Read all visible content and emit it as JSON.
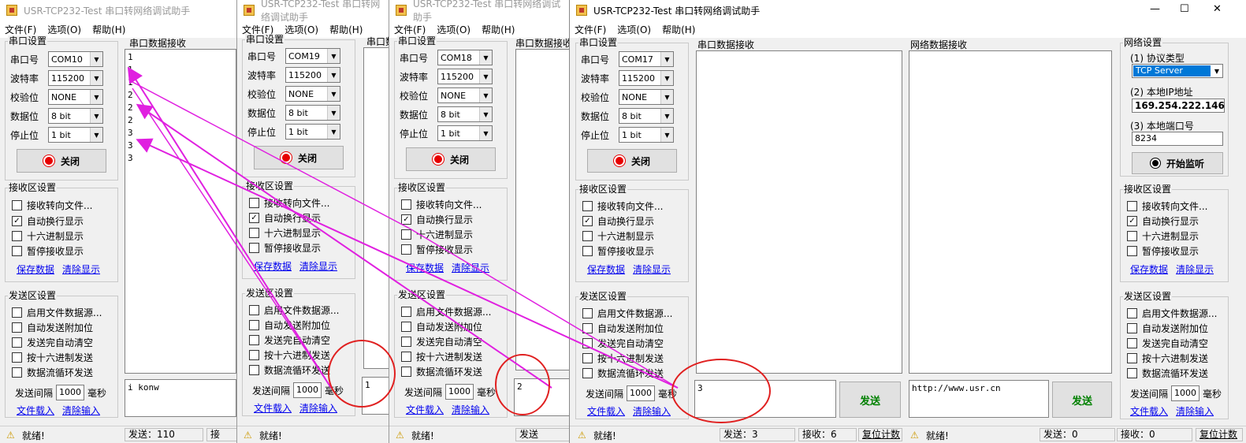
{
  "app_title": "USR-TCP232-Test 串口转网络调试助手",
  "menu": [
    "文件(F)",
    "选项(O)",
    "帮助(H)"
  ],
  "serial_group": "串口设置",
  "labels": {
    "port": "串口号",
    "baud": "波特率",
    "parity": "校验位",
    "data": "数据位",
    "stop": "停止位"
  },
  "close_btn": "关闭",
  "recv_group": "接收区设置",
  "recv_opts": [
    "接收转向文件...",
    "自动换行显示",
    "十六进制显示",
    "暂停接收显示"
  ],
  "recv_links": [
    "保存数据",
    "清除显示"
  ],
  "send_group": "发送区设置",
  "send_opts": [
    "启用文件数据源...",
    "自动发送附加位",
    "发送完自动清空",
    "按十六进制发送",
    "数据流循环发送"
  ],
  "interval_label": "发送间隔",
  "interval_val": "1000",
  "interval_unit": "毫秒",
  "send_links": [
    "文件载入",
    "清除输入"
  ],
  "serial_recv_title": "串口数据接收",
  "ready": "就绪!",
  "w1": {
    "port": "COM10",
    "baud": "115200",
    "parity": "NONE",
    "data": "8 bit",
    "stop": "1 bit",
    "recv": "1\n1\n1\n2\n2\n2\n3\n3\n3",
    "send": "i konw",
    "status_send": "发送：110",
    "status_recv": "接"
  },
  "w2": {
    "port": "COM19",
    "baud": "115200",
    "parity": "NONE",
    "data": "8 bit",
    "stop": "1 bit",
    "send": "1"
  },
  "w3": {
    "port": "COM18",
    "baud": "115200",
    "parity": "NONE",
    "data": "8 bit",
    "stop": "1 bit",
    "send": "2",
    "status_send": "发送"
  },
  "w4": {
    "port": "COM17",
    "baud": "115200",
    "parity": "NONE",
    "data": "8 bit",
    "stop": "1 bit",
    "send": "3",
    "send_btn": "发送",
    "net_recv_title": "网络数据接收",
    "net_send": "http://www.usr.cn",
    "net_send_btn": "发送",
    "status_send": "发送：3",
    "status_recv": "接收：6",
    "reset": "复位计数",
    "net_status_send": "发送：0",
    "net_status_recv": "接收：0",
    "net_reset": "复位计数"
  },
  "net": {
    "group": "网络设置",
    "proto_label": "(1) 协议类型",
    "proto": "TCP Server",
    "ip_label": "(2) 本地IP地址",
    "ip": "169.254.222.146",
    "port_label": "(3) 本地端口号",
    "port": "8234",
    "listen_btn": "开始监听"
  },
  "colors": {
    "annotation": "#e020e0",
    "circle": "#e02020"
  }
}
